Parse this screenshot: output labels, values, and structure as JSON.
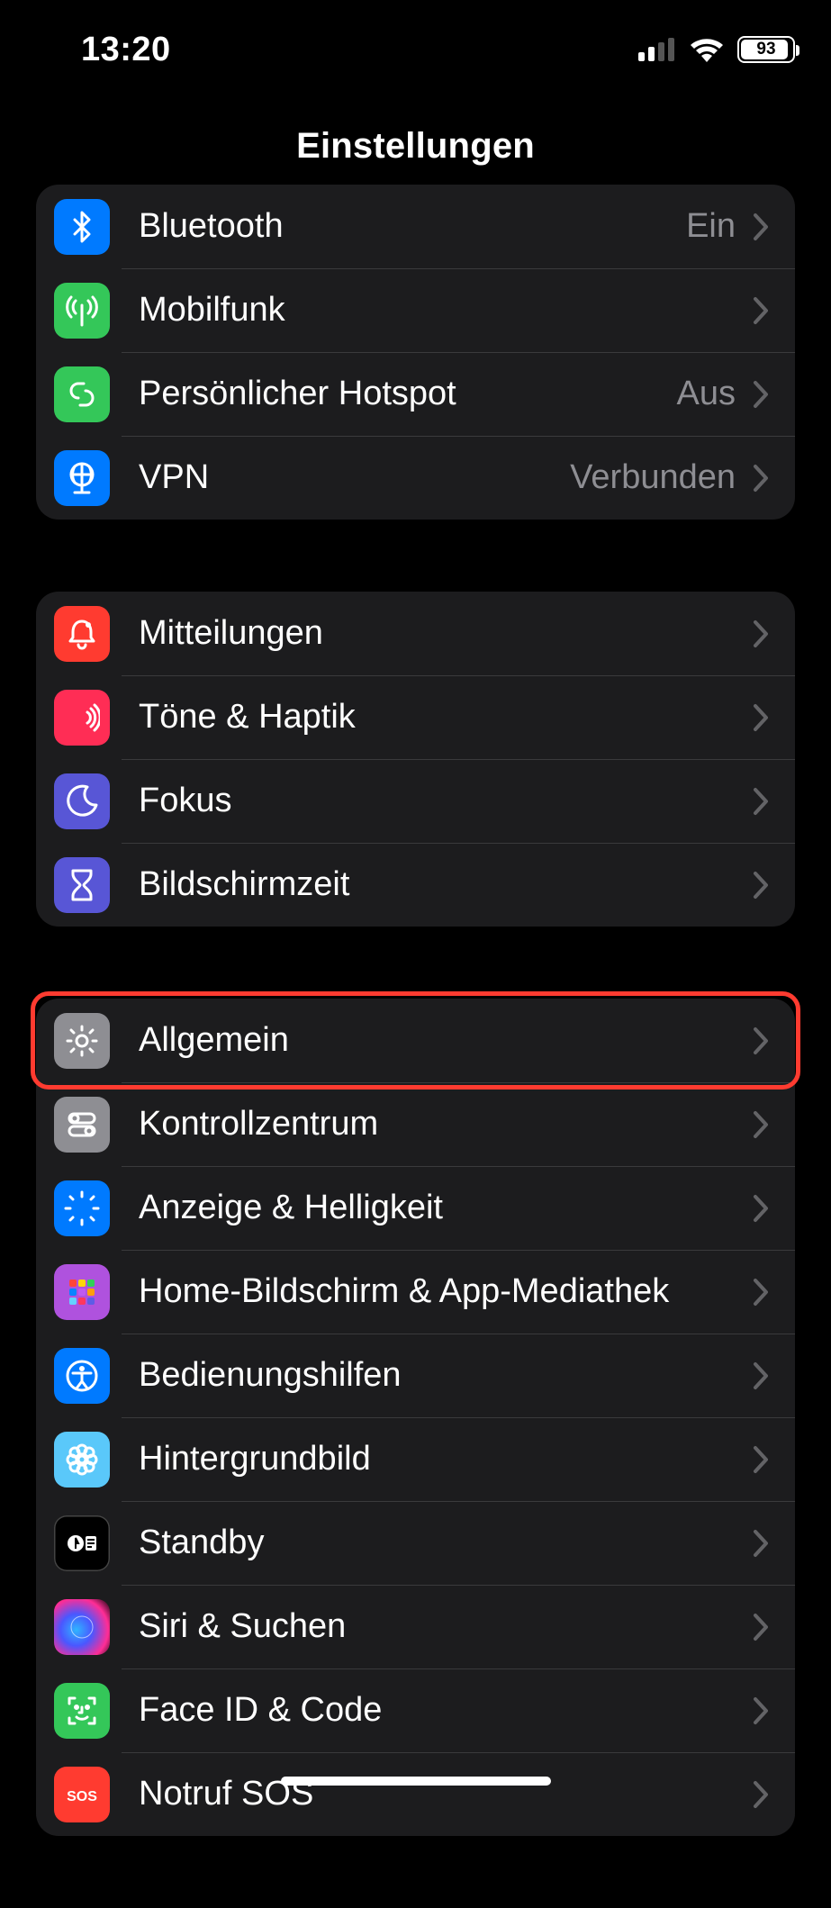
{
  "status": {
    "time": "13:20",
    "battery": "93"
  },
  "header": {
    "title": "Einstellungen"
  },
  "groups": [
    {
      "rows": [
        {
          "icon": "bluetooth",
          "name": "bluetooth",
          "label": "Bluetooth",
          "value": "Ein",
          "color": "c-blue"
        },
        {
          "icon": "antenna",
          "name": "cellular",
          "label": "Mobilfunk",
          "value": "",
          "color": "c-green"
        },
        {
          "icon": "link",
          "name": "personal-hotspot",
          "label": "Persönlicher Hotspot",
          "value": "Aus",
          "color": "c-green"
        },
        {
          "icon": "globe",
          "name": "vpn",
          "label": "VPN",
          "value": "Verbunden",
          "color": "c-blue"
        }
      ]
    },
    {
      "rows": [
        {
          "icon": "bell",
          "name": "notifications",
          "label": "Mitteilungen",
          "value": "",
          "color": "c-red"
        },
        {
          "icon": "speaker",
          "name": "sounds-haptics",
          "label": "Töne & Haptik",
          "value": "",
          "color": "c-pink"
        },
        {
          "icon": "moon",
          "name": "focus",
          "label": "Fokus",
          "value": "",
          "color": "c-indigo"
        },
        {
          "icon": "hourglass",
          "name": "screen-time",
          "label": "Bildschirmzeit",
          "value": "",
          "color": "c-indigo"
        }
      ]
    },
    {
      "rows": [
        {
          "icon": "gear",
          "name": "general",
          "label": "Allgemein",
          "value": "",
          "color": "c-gray",
          "highlight": true
        },
        {
          "icon": "switches",
          "name": "control-center",
          "label": "Kontrollzentrum",
          "value": "",
          "color": "c-gray"
        },
        {
          "icon": "sun",
          "name": "display-brightness",
          "label": "Anzeige & Helligkeit",
          "value": "",
          "color": "c-blue"
        },
        {
          "icon": "apps",
          "name": "home-screen",
          "label": "Home-Bildschirm & App-Mediathek",
          "value": "",
          "color": "c-purple"
        },
        {
          "icon": "accessibility",
          "name": "accessibility",
          "label": "Bedienungshilfen",
          "value": "",
          "color": "c-blue"
        },
        {
          "icon": "flower",
          "name": "wallpaper",
          "label": "Hintergrundbild",
          "value": "",
          "color": "c-cyan"
        },
        {
          "icon": "standby",
          "name": "standby",
          "label": "Standby",
          "value": "",
          "color": "c-black"
        },
        {
          "icon": "siri",
          "name": "siri-search",
          "label": "Siri & Suchen",
          "value": "",
          "color": "c-siri"
        },
        {
          "icon": "faceid",
          "name": "faceid-passcode",
          "label": "Face ID & Code",
          "value": "",
          "color": "c-green"
        },
        {
          "icon": "sos",
          "name": "emergency-sos",
          "label": "Notruf SOS",
          "value": "",
          "color": "c-red"
        }
      ]
    }
  ]
}
